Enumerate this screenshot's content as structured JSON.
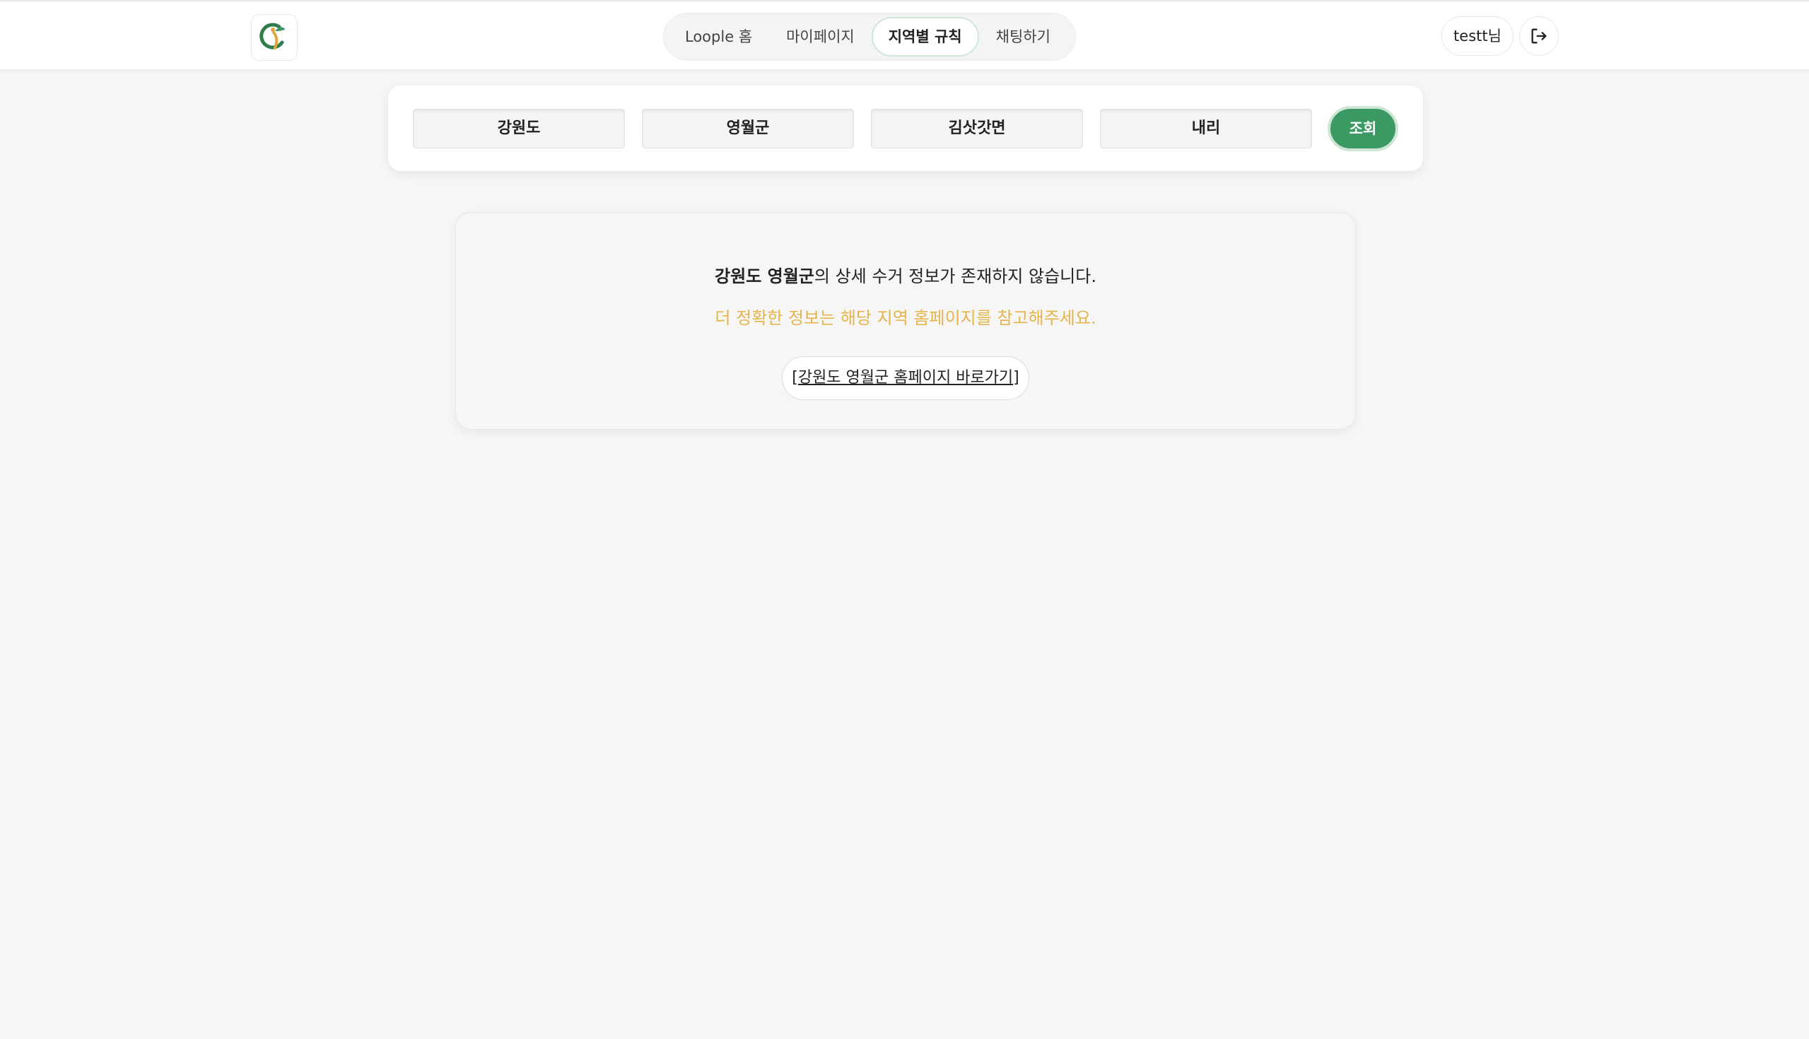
{
  "header": {
    "logo_icon": "loople-logo-icon",
    "nav": [
      {
        "label": "Loople 홈",
        "active": false
      },
      {
        "label": "마이페이지",
        "active": false
      },
      {
        "label": "지역별 규칙",
        "active": true
      },
      {
        "label": "채팅하기",
        "active": false
      }
    ],
    "user_label": "testt님",
    "logout_icon": "logout-icon"
  },
  "filters": {
    "province": "강원도",
    "county": "영월군",
    "town": "김삿갓면",
    "village": "내리",
    "search_label": "조회"
  },
  "result": {
    "region_name": "강원도 영월군",
    "message_suffix": "의 상세 수거 정보가 존재하지 않습니다.",
    "hint": "더 정확한 정보는 해당 지역 홈페이지를 참고해주세요.",
    "link_open": "[",
    "link_label": "강원도 영월군 홈페이지 바로가기",
    "link_close": "]"
  },
  "colors": {
    "accent_green": "#3b9a63",
    "hint_yellow": "#e6b44a",
    "background": "#f6f6f6"
  }
}
